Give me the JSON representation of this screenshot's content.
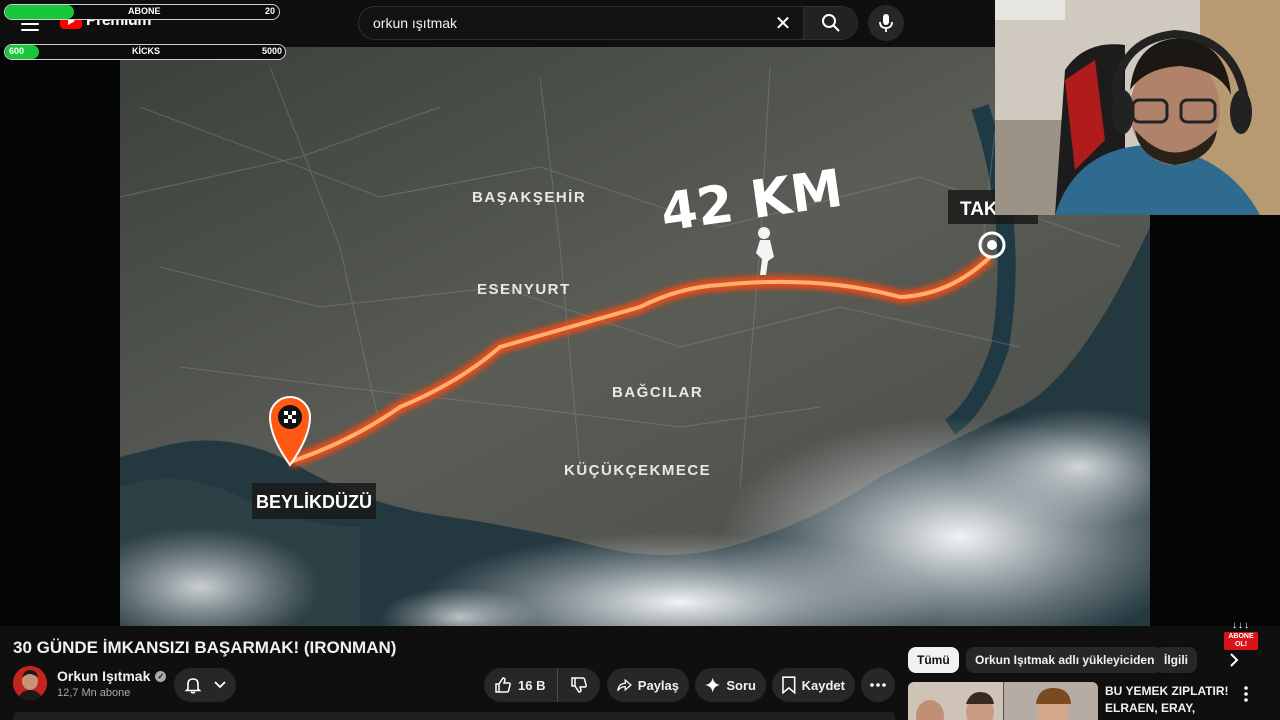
{
  "header": {
    "logo_text": "Premium",
    "search_value": "orkun ışıtmak"
  },
  "overlays": {
    "abone_bar": {
      "label": "ABONE",
      "start": "",
      "goal": "20",
      "fill_fraction": 0.25
    },
    "kicks_bar": {
      "label": "KİCKS",
      "start": "600",
      "goal": "5000",
      "fill_fraction": 0.12
    }
  },
  "video": {
    "map_labels": {
      "distance": "42 KM",
      "start_point": "BEYLİKDÜZÜ",
      "end_point": "TAKS",
      "district_1": "BAŞAKŞEHİR",
      "district_2": "ESENYURT",
      "district_3": "BAĞCILAR",
      "district_4": "KÜÇÜKÇEKMECE"
    },
    "badge": {
      "arrows": "↓↓↓",
      "line1": "ABONE",
      "line2": "OL!"
    }
  },
  "meta": {
    "title": "30 GÜNDE İMKANSIZI BAŞARMAK! (IRONMAN)",
    "channel": "Orkun Işıtmak",
    "subscribers": "12,7 Mn abone",
    "likes": "16 B",
    "share_label": "Paylaş",
    "ask_label": "Soru",
    "save_label": "Kaydet"
  },
  "sidebar": {
    "chips": [
      "Tümü",
      "Orkun Işıtmak adlı yükleyiciden",
      "İlgili"
    ],
    "rec_title": "BU YEMEK ZIPLATIR! ELRAEN, ERAY, LIMON,..."
  },
  "colors": {
    "route": "#ff5a14",
    "bar_fill": "#19c83a",
    "accent_red": "#ff0000"
  }
}
